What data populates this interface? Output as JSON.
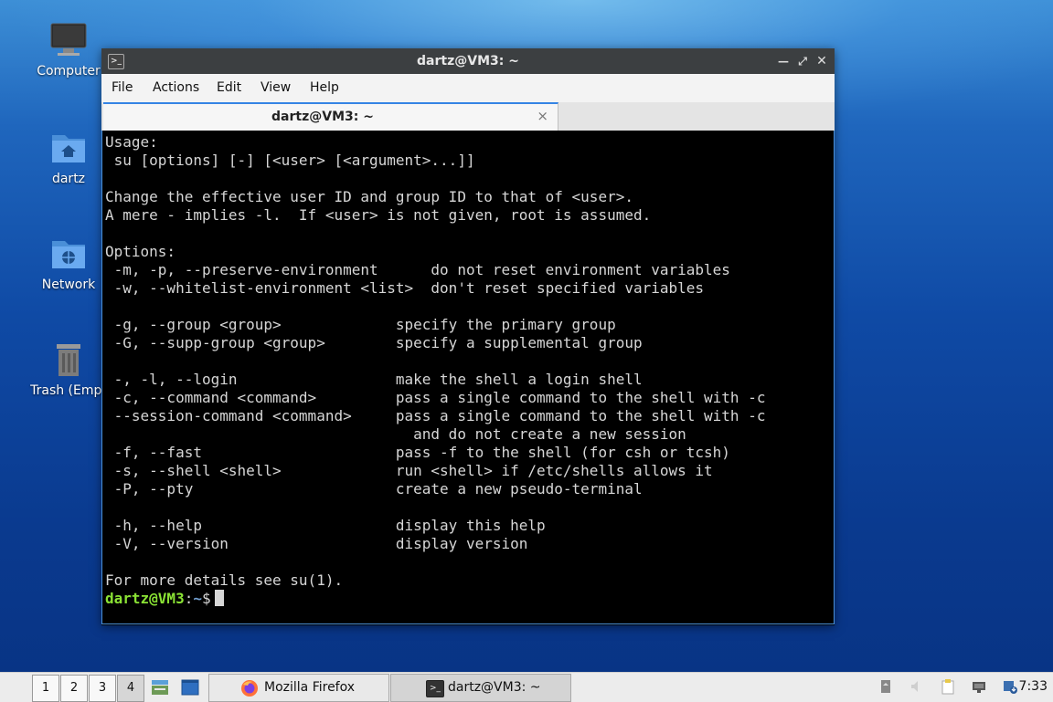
{
  "desktop": {
    "icons": [
      {
        "label": "Computer"
      },
      {
        "label": "dartz"
      },
      {
        "label": "Network"
      },
      {
        "label": "Trash (Empt"
      }
    ]
  },
  "window": {
    "title": "dartz@VM3: ~",
    "menu": [
      "File",
      "Actions",
      "Edit",
      "View",
      "Help"
    ],
    "tab_label": "dartz@VM3: ~",
    "tab_close": "×"
  },
  "terminal": {
    "output": "Usage:\n su [options] [-] [<user> [<argument>...]]\n\nChange the effective user ID and group ID to that of <user>.\nA mere - implies -l.  If <user> is not given, root is assumed.\n\nOptions:\n -m, -p, --preserve-environment      do not reset environment variables\n -w, --whitelist-environment <list>  don't reset specified variables\n\n -g, --group <group>             specify the primary group\n -G, --supp-group <group>        specify a supplemental group\n\n -, -l, --login                  make the shell a login shell\n -c, --command <command>         pass a single command to the shell with -c\n --session-command <command>     pass a single command to the shell with -c\n                                   and do not create a new session\n -f, --fast                      pass -f to the shell (for csh or tcsh)\n -s, --shell <shell>             run <shell> if /etc/shells allows it\n -P, --pty                       create a new pseudo-terminal\n\n -h, --help                      display this help\n -V, --version                   display version\n\nFor more details see su(1).\n",
    "prompt_user": "dartz@VM3",
    "prompt_sep": ":",
    "prompt_path": "~",
    "prompt_symbol": "$"
  },
  "taskbar": {
    "workspaces": [
      "1",
      "2",
      "3",
      "4"
    ],
    "active_workspace": "4",
    "tasks": [
      {
        "label": "Mozilla Firefox",
        "icon": "firefox-icon"
      },
      {
        "label": "dartz@VM3: ~",
        "icon": "terminal-icon"
      }
    ],
    "clock": "7:33"
  }
}
